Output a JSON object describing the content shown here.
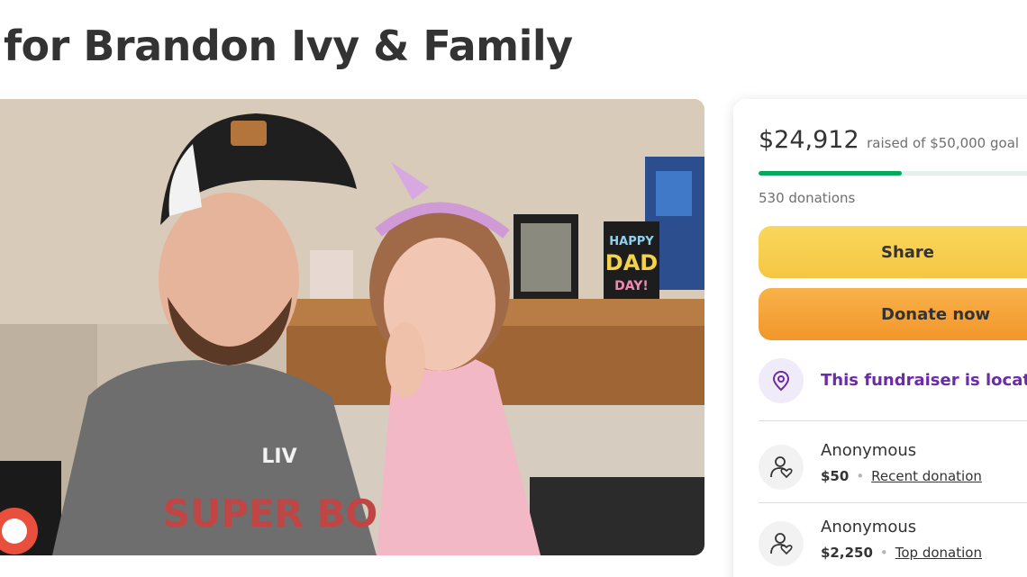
{
  "page": {
    "title": "for Brandon Ivy & Family"
  },
  "hero": {
    "shirt_text": "LIV",
    "shirt_text_2": "SUPER BO",
    "sign_line_1": "HAPPY",
    "sign_line_2": "DAD",
    "sign_line_3": "DAY!"
  },
  "donation": {
    "raised_amount": "$24,912",
    "goal_text": "raised of $50,000 goal",
    "progress_fraction": 0.498,
    "donation_count": "530 donations",
    "share_label": "Share",
    "donate_label": "Donate now",
    "location_text": "This fundraiser is located",
    "location_icon": "map-pin-icon",
    "donors": [
      {
        "name": "Anonymous",
        "amount": "$50",
        "tag": "Recent donation"
      },
      {
        "name": "Anonymous",
        "amount": "$2,250",
        "tag": "Top donation"
      }
    ]
  },
  "colors": {
    "progress": "#02a95c",
    "share_button": "#f5c644",
    "donate_button": "#f2962a",
    "location_text": "#6c2ba8",
    "title_text": "#333333"
  }
}
